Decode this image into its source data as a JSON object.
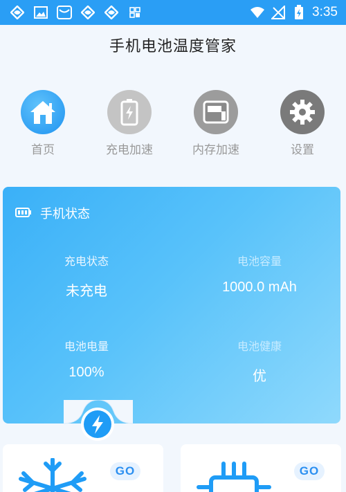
{
  "status_bar": {
    "time": "3:35",
    "left_icons": [
      "app-icon",
      "image-icon",
      "mail-icon",
      "app-icon",
      "app-icon",
      "grid-icon"
    ],
    "right_icons": [
      "wifi-icon",
      "no-signal-icon",
      "battery-charging-icon"
    ]
  },
  "app": {
    "title": "手机电池温度管家"
  },
  "nav": [
    {
      "label": "首页",
      "icon": "home-icon",
      "color": "#2a9ef5"
    },
    {
      "label": "充电加速",
      "icon": "battery-icon",
      "color": "#b9b9b9"
    },
    {
      "label": "内存加速",
      "icon": "memory-icon",
      "color": "#9a9a9a"
    },
    {
      "label": "设置",
      "icon": "gear-icon",
      "color": "#777777"
    }
  ],
  "status_card": {
    "title": "手机状态",
    "stats": [
      {
        "label": "充电状态",
        "value": "未充电"
      },
      {
        "label": "电池容量",
        "value": "1000.0 mAh"
      },
      {
        "label": "电池电量",
        "value": "100%"
      },
      {
        "label": "电池健康",
        "value": "优"
      }
    ]
  },
  "feature_cards": [
    {
      "icon": "snowflake-icon",
      "go": "GO"
    },
    {
      "icon": "chip-icon",
      "go": "GO"
    }
  ],
  "colors": {
    "accent": "#2a9ef5",
    "card_gradient_start": "#3ab0f8",
    "card_gradient_end": "#8fd9fc"
  }
}
